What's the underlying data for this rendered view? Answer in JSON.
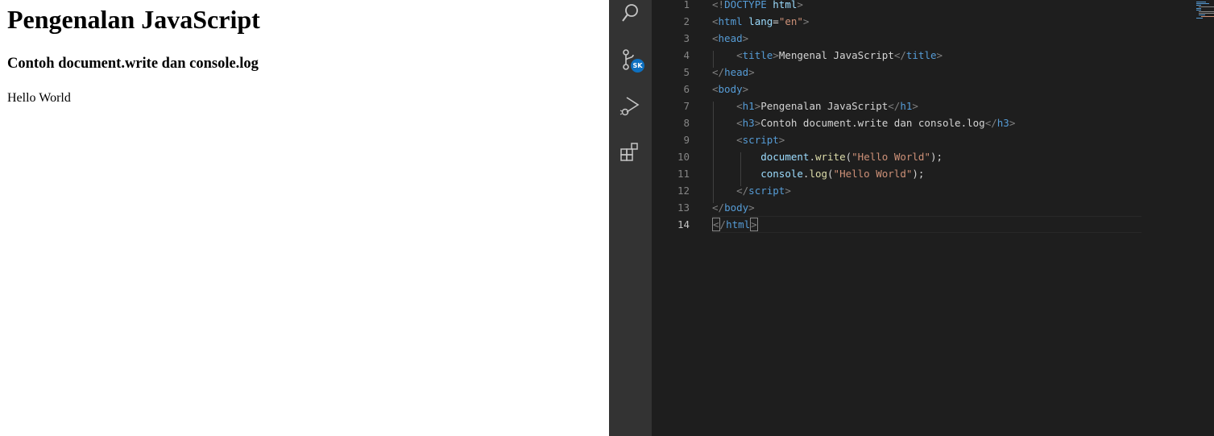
{
  "preview": {
    "heading": "Pengenalan JavaScript",
    "subheading": "Contoh document.write dan console.log",
    "output": "Hello World"
  },
  "editor": {
    "activity_bar": {
      "source_control_badge": "SK",
      "icons": [
        "search-icon",
        "source-control-icon",
        "run-debug-icon",
        "extensions-icon"
      ]
    },
    "lines": [
      {
        "n": "1",
        "tokens": [
          [
            "punc",
            "<!"
          ],
          [
            "tag",
            "DOCTYPE"
          ],
          [
            "text",
            " "
          ],
          [
            "attr",
            "html"
          ],
          [
            "punc",
            ">"
          ]
        ]
      },
      {
        "n": "2",
        "tokens": [
          [
            "punc",
            "<"
          ],
          [
            "tag",
            "html"
          ],
          [
            "text",
            " "
          ],
          [
            "attr",
            "lang"
          ],
          [
            "text",
            "="
          ],
          [
            "str",
            "\"en\""
          ],
          [
            "punc",
            ">"
          ]
        ]
      },
      {
        "n": "3",
        "tokens": [
          [
            "punc",
            "<"
          ],
          [
            "tag",
            "head"
          ],
          [
            "punc",
            ">"
          ]
        ]
      },
      {
        "n": "4",
        "tokens": [
          [
            "text",
            "    "
          ],
          [
            "punc",
            "<"
          ],
          [
            "tag",
            "title"
          ],
          [
            "punc",
            ">"
          ],
          [
            "text",
            "Mengenal JavaScript"
          ],
          [
            "punc",
            "</"
          ],
          [
            "tag",
            "title"
          ],
          [
            "punc",
            ">"
          ]
        ]
      },
      {
        "n": "5",
        "tokens": [
          [
            "punc",
            "</"
          ],
          [
            "tag",
            "head"
          ],
          [
            "punc",
            ">"
          ]
        ]
      },
      {
        "n": "6",
        "tokens": [
          [
            "punc",
            "<"
          ],
          [
            "tag",
            "body"
          ],
          [
            "punc",
            ">"
          ]
        ]
      },
      {
        "n": "7",
        "tokens": [
          [
            "text",
            "    "
          ],
          [
            "punc",
            "<"
          ],
          [
            "tag",
            "h1"
          ],
          [
            "punc",
            ">"
          ],
          [
            "text",
            "Pengenalan JavaScript"
          ],
          [
            "punc",
            "</"
          ],
          [
            "tag",
            "h1"
          ],
          [
            "punc",
            ">"
          ]
        ]
      },
      {
        "n": "8",
        "tokens": [
          [
            "text",
            "    "
          ],
          [
            "punc",
            "<"
          ],
          [
            "tag",
            "h3"
          ],
          [
            "punc",
            ">"
          ],
          [
            "text",
            "Contoh document.write dan console.log"
          ],
          [
            "punc",
            "</"
          ],
          [
            "tag",
            "h3"
          ],
          [
            "punc",
            ">"
          ]
        ]
      },
      {
        "n": "9",
        "tokens": [
          [
            "text",
            "    "
          ],
          [
            "punc",
            "<"
          ],
          [
            "tag",
            "script"
          ],
          [
            "punc",
            ">"
          ]
        ]
      },
      {
        "n": "10",
        "tokens": [
          [
            "text",
            "        "
          ],
          [
            "attr",
            "document"
          ],
          [
            "text",
            "."
          ],
          [
            "fn",
            "write"
          ],
          [
            "text",
            "("
          ],
          [
            "str",
            "\"Hello World\""
          ],
          [
            "text",
            ");"
          ]
        ]
      },
      {
        "n": "11",
        "tokens": [
          [
            "text",
            "        "
          ],
          [
            "attr",
            "console"
          ],
          [
            "text",
            "."
          ],
          [
            "fn",
            "log"
          ],
          [
            "text",
            "("
          ],
          [
            "str",
            "\"Hello World\""
          ],
          [
            "text",
            ");"
          ]
        ]
      },
      {
        "n": "12",
        "tokens": [
          [
            "text",
            "    "
          ],
          [
            "punc",
            "</"
          ],
          [
            "tag",
            "script"
          ],
          [
            "punc",
            ">"
          ]
        ]
      },
      {
        "n": "13",
        "tokens": [
          [
            "punc",
            "</"
          ],
          [
            "tag",
            "body"
          ],
          [
            "punc",
            ">"
          ]
        ]
      },
      {
        "n": "14",
        "tokens": [
          [
            "punc",
            "<"
          ],
          [
            "punc",
            "/"
          ],
          [
            "tag",
            "html"
          ],
          [
            "punc",
            ">"
          ]
        ]
      }
    ],
    "active_line": "14"
  },
  "colors": {
    "editor_bg": "#1e1e1e",
    "activity_bar_bg": "#333333",
    "tag": "#569cd6",
    "punctuation": "#808080",
    "attribute": "#9cdcfe",
    "string": "#ce9178",
    "function": "#dcdcaa",
    "text": "#d4d4d4",
    "badge": "#0e70c0"
  }
}
